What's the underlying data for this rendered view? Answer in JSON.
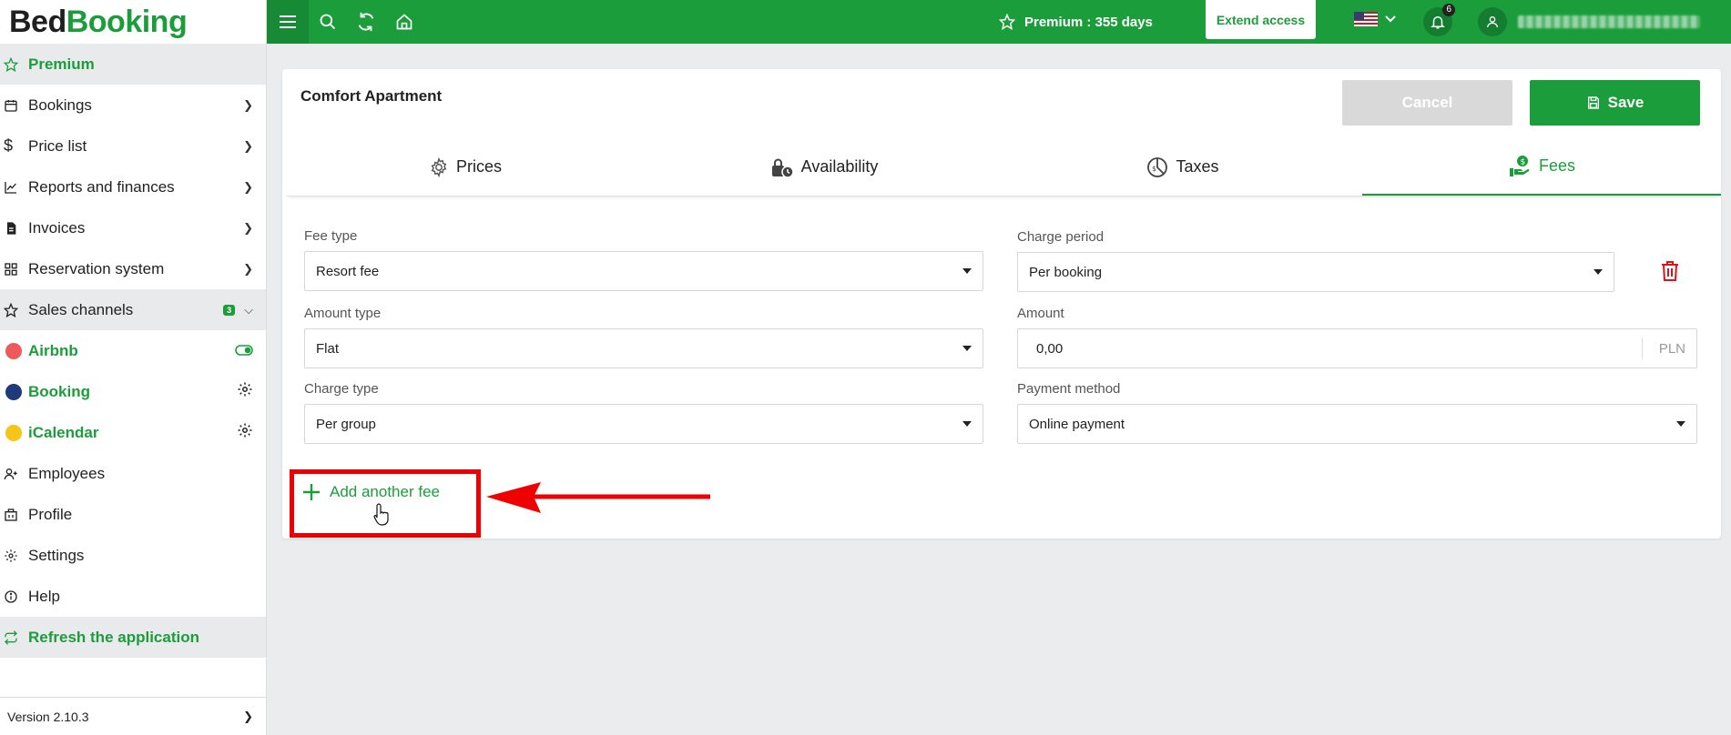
{
  "logo": {
    "part1": "Bed",
    "part2": "Booking"
  },
  "sidebar": {
    "items": [
      {
        "label": "Premium",
        "icon": "star-icon"
      },
      {
        "label": "Bookings",
        "icon": "calendar-icon"
      },
      {
        "label": "Price list",
        "icon": "dollar-icon"
      },
      {
        "label": "Reports and finances",
        "icon": "chart-icon"
      },
      {
        "label": "Invoices",
        "icon": "invoice-icon"
      },
      {
        "label": "Reservation system",
        "icon": "grid-icon"
      },
      {
        "label": "Sales channels",
        "icon": "star-outline-icon",
        "badge": "3"
      },
      {
        "label": "Airbnb",
        "color": "#ee5a5a"
      },
      {
        "label": "Booking",
        "color": "#1f3a7a"
      },
      {
        "label": "iCalendar",
        "color": "#f5c518"
      },
      {
        "label": "Employees",
        "icon": "user-add-icon"
      },
      {
        "label": "Profile",
        "icon": "building-icon"
      },
      {
        "label": "Settings",
        "icon": "gear-icon"
      },
      {
        "label": "Help",
        "icon": "info-icon"
      },
      {
        "label": "Refresh the application",
        "icon": "refresh-icon"
      }
    ],
    "version": "Version 2.10.3"
  },
  "topbar": {
    "premium_text": "Premium : 355 days",
    "extend_label": "Extend access",
    "notifications_count": "6"
  },
  "card": {
    "title": "Comfort Apartment",
    "cancel_label": "Cancel",
    "save_label": "Save",
    "tabs": [
      {
        "label": "Prices",
        "icon": "gear-icon"
      },
      {
        "label": "Availability",
        "icon": "lock-clock-icon"
      },
      {
        "label": "Taxes",
        "icon": "tax-icon"
      },
      {
        "label": "Fees",
        "icon": "money-hand-icon",
        "active": true
      }
    ],
    "fields": {
      "fee_type": {
        "label": "Fee type",
        "value": "Resort fee"
      },
      "charge_period": {
        "label": "Charge period",
        "value": "Per booking"
      },
      "amount_type": {
        "label": "Amount type",
        "value": "Flat"
      },
      "amount": {
        "label": "Amount",
        "value": "0,00",
        "currency": "PLN"
      },
      "charge_type": {
        "label": "Charge type",
        "value": "Per group"
      },
      "payment_method": {
        "label": "Payment method",
        "value": "Online payment"
      }
    },
    "add_fee_label": "Add another fee"
  },
  "colors": {
    "brand": "#1c9d3c",
    "highlight": "#e00000"
  }
}
